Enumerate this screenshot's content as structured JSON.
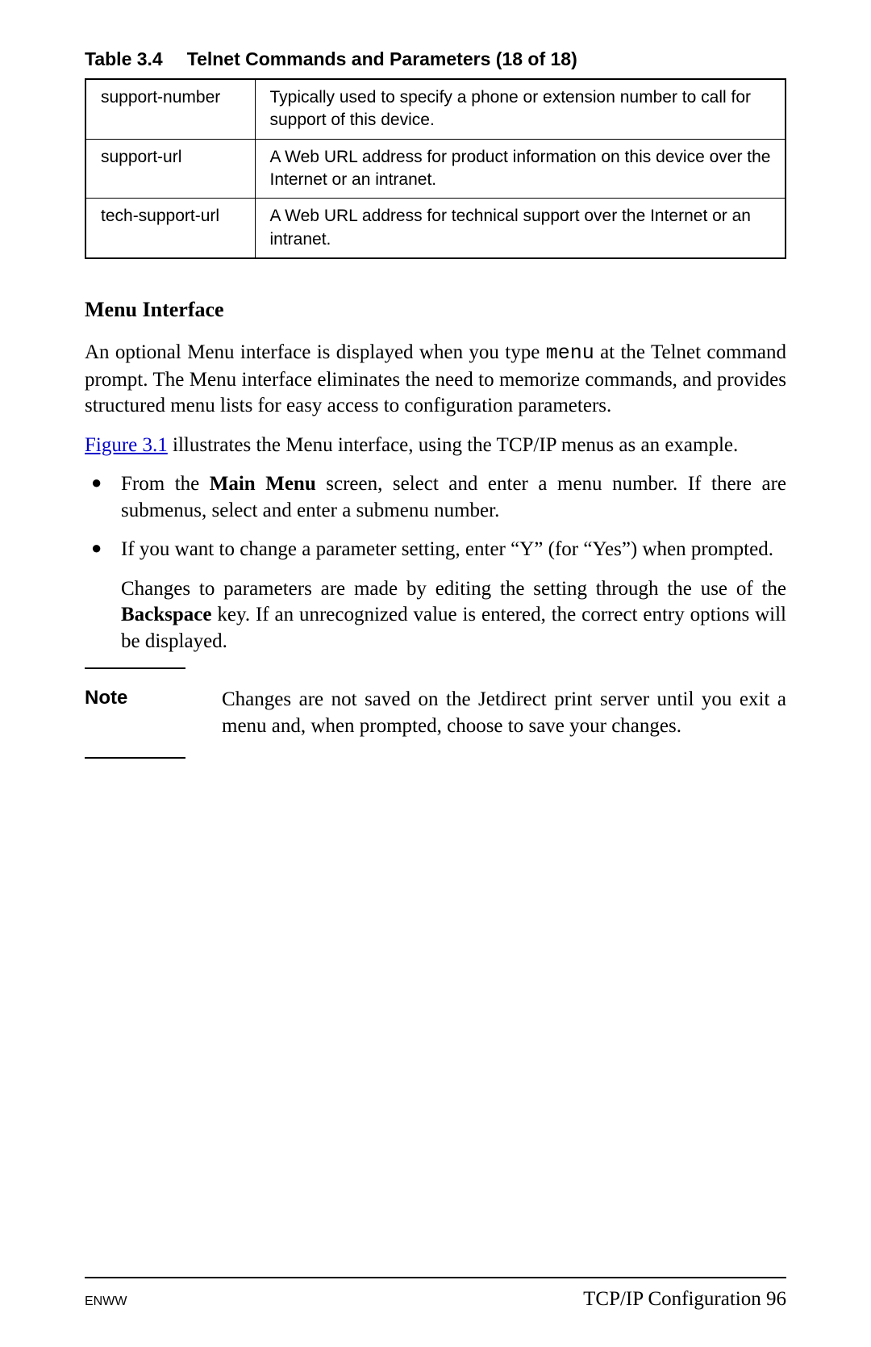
{
  "table": {
    "caption_num": "Table 3.4",
    "caption_title": "Telnet Commands and Parameters (18 of 18)",
    "rows": [
      {
        "cmd": "support-number",
        "desc": "Typically used to specify a phone or extension number to call for support of this device."
      },
      {
        "cmd": "support-url",
        "desc": "A Web URL address for product information on this device over the Internet or an intranet."
      },
      {
        "cmd": "tech-support-url",
        "desc": "A Web URL address for technical support over the Internet or an intranet."
      }
    ]
  },
  "section": {
    "heading": "Menu Interface",
    "para1_a": "An optional Menu interface is displayed when you type ",
    "para1_mono": "menu",
    "para1_b": " at the Telnet command prompt. The Menu interface eliminates the need to memorize commands, and provides structured menu lists for easy access to configuration parameters.",
    "para2_link": "Figure 3.1",
    "para2_rest": " illustrates the Menu interface, using the TCP/IP menus as an example.",
    "bullet1_a": "From the ",
    "bullet1_bold": "Main Menu",
    "bullet1_b": " screen, select and enter a menu number. If there are submenus, select and enter a submenu number.",
    "bullet2": "If you want to change a parameter setting, enter “Y” (for “Yes”) when prompted.",
    "bullet2_follow_a": "Changes to parameters are made by editing the setting through the use of the ",
    "bullet2_follow_bold": "Backspace",
    "bullet2_follow_b": " key. If an unrecognized value is entered, the correct entry options will be displayed.",
    "note_label": "Note",
    "note_text": "Changes are not saved on the Jetdirect print server until you exit a menu and, when prompted, choose to save your changes."
  },
  "footer": {
    "left": "ENWW",
    "right": "TCP/IP Configuration 96"
  }
}
